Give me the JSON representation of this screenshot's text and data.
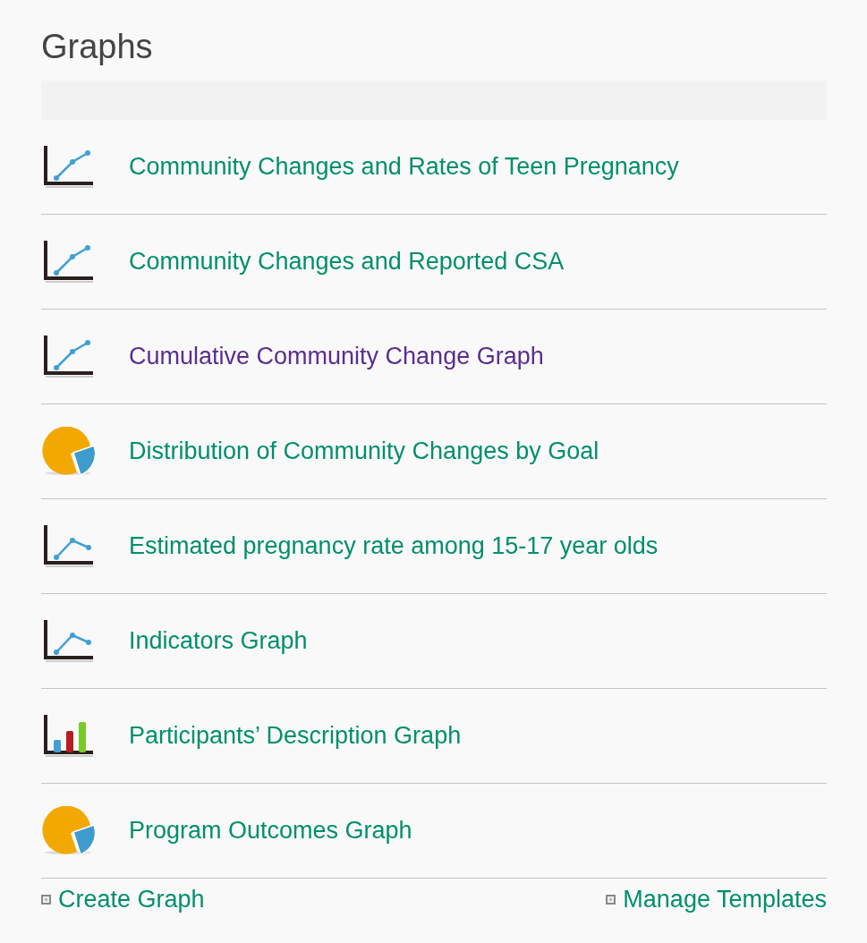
{
  "title": "Graphs",
  "graphs": [
    {
      "label": "Community Changes and Rates of Teen Pregnancy",
      "kind": "rising",
      "visited": false
    },
    {
      "label": "Community Changes and Reported CSA",
      "kind": "rising",
      "visited": false
    },
    {
      "label": "Cumulative Community Change Graph",
      "kind": "rising",
      "visited": true
    },
    {
      "label": "Distribution of Community Changes by Goal",
      "kind": "pie",
      "visited": false
    },
    {
      "label": "Estimated pregnancy rate among 15-17 year olds",
      "kind": "peak",
      "visited": false
    },
    {
      "label": "Indicators Graph",
      "kind": "peak",
      "visited": false
    },
    {
      "label": "Participants’ Description Graph",
      "kind": "bar",
      "visited": false
    },
    {
      "label": "Program Outcomes Graph",
      "kind": "pie",
      "visited": false
    }
  ],
  "actions": [
    {
      "label": "Create Graph"
    },
    {
      "label": "Manage Templates"
    }
  ]
}
